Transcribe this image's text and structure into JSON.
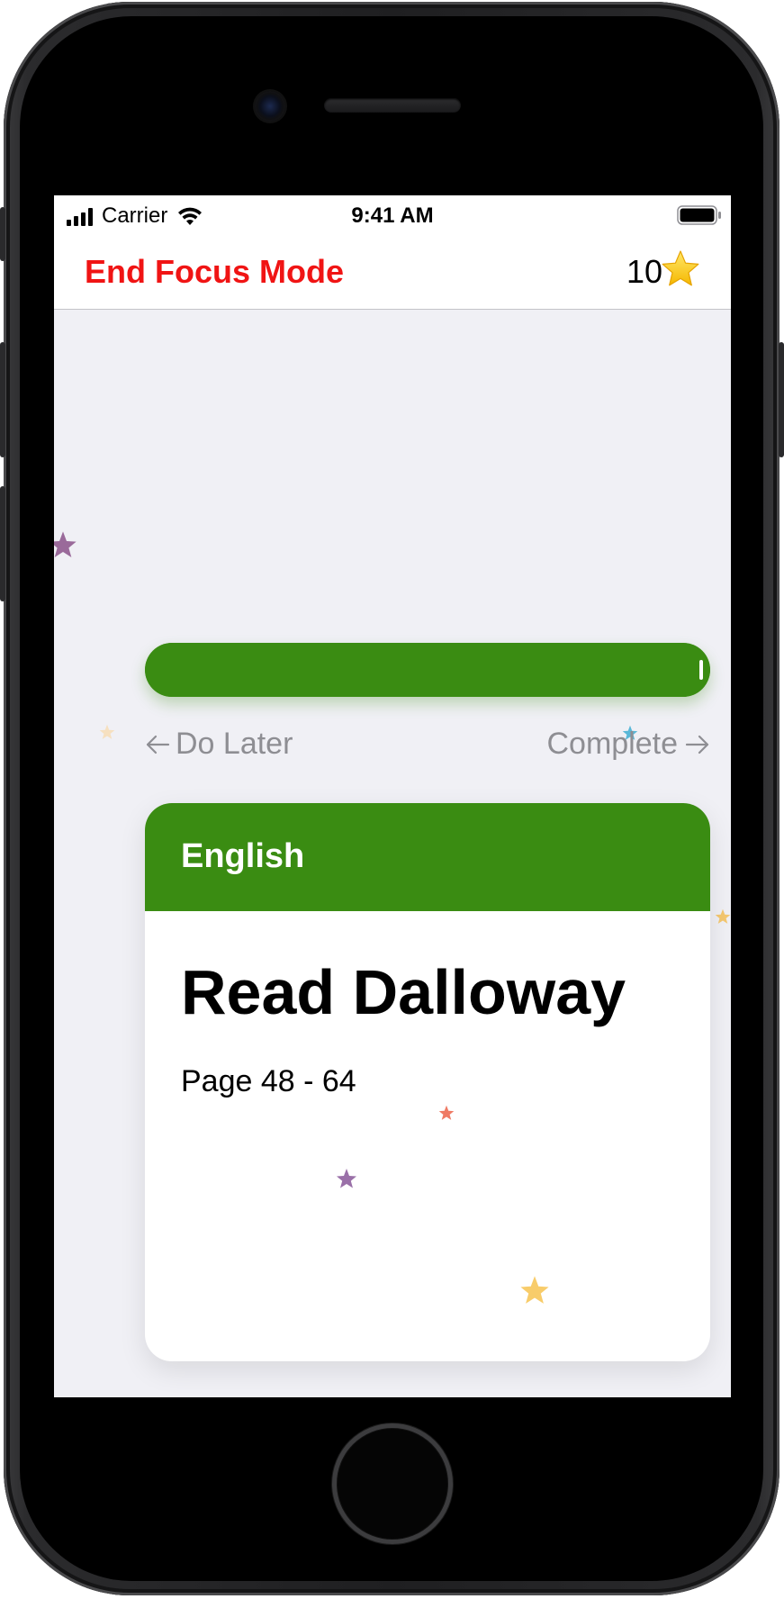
{
  "status_bar": {
    "carrier": "Carrier",
    "time": "9:41 AM"
  },
  "nav": {
    "end_focus_label": "End Focus Mode",
    "star_count": "10",
    "star_icon": "star-icon"
  },
  "progress": {
    "fraction": 1.0,
    "color": "#3a8c12"
  },
  "actions": {
    "do_later_label": "Do Later",
    "complete_label": "Complete"
  },
  "task": {
    "subject": "English",
    "title": "Read Dalloway",
    "detail": "Page 48 - 64",
    "accent_color": "#3a8c12"
  },
  "colors": {
    "accent_red": "#f01414",
    "accent_green": "#3a8c12",
    "background": "#f0f0f5"
  }
}
